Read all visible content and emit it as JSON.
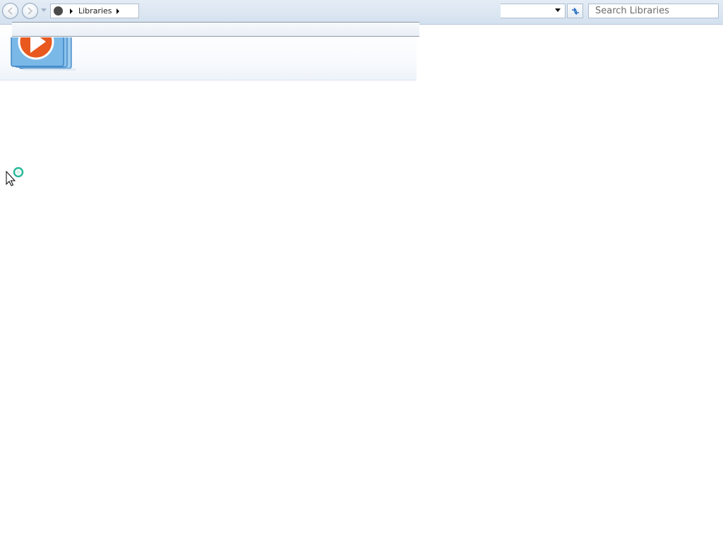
{
  "window": {
    "type": "explorer-library-view"
  },
  "navigation": {
    "back_icon": "back-arrow-icon",
    "forward_icon": "forward-arrow-icon",
    "recent_icon": "chevron-down-icon"
  },
  "address_bar": {
    "root_icon": "libraries-root-icon",
    "crumbs": [
      {
        "label": "Libraries"
      }
    ],
    "dropdown_icon": "chevron-down-icon",
    "refresh_icon": "refresh-icon"
  },
  "search": {
    "placeholder": "Search Libraries"
  },
  "header": {
    "library_icon": "media-player-icon"
  },
  "cursor": {
    "state": "busy",
    "icon": "busy-cursor-icon"
  },
  "colors": {
    "nav_bar": "#dbe6f2",
    "border": "#aebdce",
    "accent_orange": "#e8581f",
    "icon_blue": "#5fa9e0"
  }
}
